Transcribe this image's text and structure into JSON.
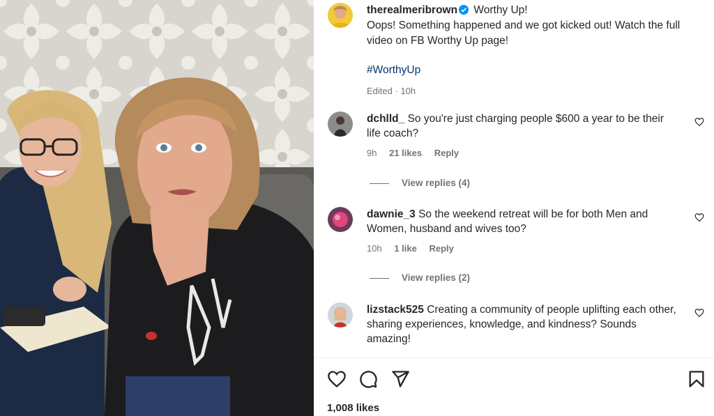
{
  "post": {
    "username": "therealmeribrown",
    "caption_title": "Worthy Up!",
    "caption_body": "Oops! Something happened and we got kicked out! Watch the full video on FB Worthy Up page!",
    "hashtag": "#WorthyUp",
    "edited_label": "Edited",
    "time": "10h",
    "verified_icon": "verified-badge-icon",
    "accent_color": "#0095f6"
  },
  "comments": [
    {
      "username": "dchlld_",
      "text": "So you're just charging people $600 a year to be their life coach?",
      "time": "9h",
      "likes": "21 likes",
      "reply_label": "Reply",
      "view_replies": "View replies (4)"
    },
    {
      "username": "dawnie_3",
      "text": "So the weekend retreat will be for both Men and Women, husband and wives too?",
      "time": "10h",
      "likes": "1 like",
      "reply_label": "Reply",
      "view_replies": "View replies (2)"
    },
    {
      "username": "lizstack525",
      "text": "Creating a community of people uplifting each other, sharing experiences, knowledge, and kindness? Sounds amazing!"
    }
  ],
  "actions": {
    "like_icon": "heart-icon",
    "comment_icon": "comment-icon",
    "share_icon": "share-icon",
    "save_icon": "bookmark-icon"
  },
  "likes_count": "1,008 likes"
}
